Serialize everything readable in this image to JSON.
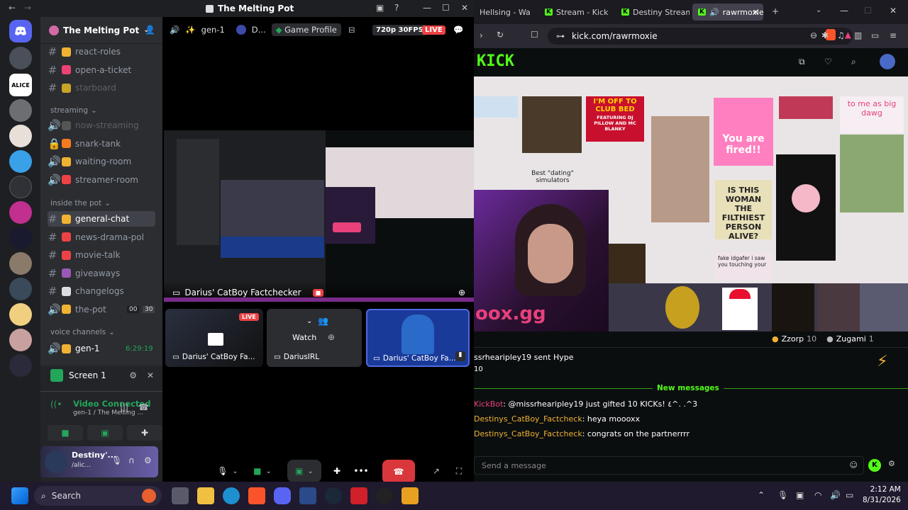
{
  "discord": {
    "window_title": "The Melting Pot",
    "guild_name": "The Melting Pot",
    "channels_top": [
      {
        "name": "react-roles",
        "color": "#f0b232"
      },
      {
        "name": "open-a-ticket",
        "color": "#ed4274"
      },
      {
        "name": "starboard",
        "color": "#c9a227"
      }
    ],
    "cat_streaming": "streaming",
    "streaming_channels": [
      {
        "name": "now-streaming",
        "color": "#555"
      },
      {
        "name": "snark-tank",
        "color": "#f47b20"
      },
      {
        "name": "waiting-room",
        "color": "#f0b232"
      },
      {
        "name": "streamer-room",
        "color": "#ed4245"
      }
    ],
    "cat_inside": "inside the pot",
    "inside_channels": [
      {
        "name": "general-chat",
        "color": "#f0b232"
      },
      {
        "name": "news-drama-pol",
        "color": "#ed4245"
      },
      {
        "name": "movie-talk",
        "color": "#ed4245"
      },
      {
        "name": "giveaways",
        "color": "#9b59b6"
      },
      {
        "name": "changelogs",
        "color": "#dbdee1"
      },
      {
        "name": "the-pot",
        "color": "#f0b232"
      }
    ],
    "the_pot_user_count": "00",
    "the_pot_limit": "30",
    "cat_voice": "voice channels",
    "voice_channel": "gen-1",
    "voice_timer": "6:29:19",
    "screen_label": "Screen 1",
    "voice_status": "Video Connected",
    "voice_sub": "gen-1 / The Melting ...",
    "user_name": "Destiny'...",
    "user_status": "/alic...",
    "stage": {
      "channel": "gen-1",
      "user_short": "D...",
      "game_profile": "Game Profile",
      "quality": "720p 30FPS",
      "live": "LIVE",
      "stream_name": "Darius' CatBoy Factchecker",
      "tiles": [
        {
          "label": "Darius' CatBoy Fa...",
          "live": "LIVE"
        },
        {
          "label": "DariusIRL",
          "watch": "Watch"
        },
        {
          "label": "Darius' CatBoy Fa..."
        }
      ]
    }
  },
  "browser": {
    "tabs": [
      "Hellsing - Wat",
      "Stream - Kick",
      "Destiny Stream",
      "rawrmoxie"
    ],
    "url": "kick.com/rawrmoxie",
    "kick_logo": "KICK",
    "feed": {
      "club_bed": "I'M OFF TO CLUB BED",
      "club_sub": "FEATURING DJ PILLOW AND MC BLANKY",
      "big_dawg": "to me as big dawg",
      "best_dating": "Best \"dating\" simulators",
      "fired": "You are fired!!",
      "filthiest": "IS THIS WOMAN THE FILTHIEST PERSON ALIVE?",
      "idgafer": "fake idgafer i saw you touching your",
      "watermark": "oox.gg"
    },
    "gifters": [
      {
        "name": "Zzorp",
        "count": "10"
      },
      {
        "name": "Zugami",
        "count": "1"
      }
    ],
    "hype_text": "ssrhearipley19 sent Hype",
    "hype_count": "10",
    "new_messages": "New messages",
    "messages": [
      {
        "user": "KickBot",
        "user_color": "#e8417b",
        "text": ": @missrhearipley19 just gifted 10 KICKs! ٤^. .^3"
      },
      {
        "user": "Destinys_CatBoy_Factcheck",
        "user_color": "#f0b232",
        "text": ": heya moooxx"
      },
      {
        "user": "Destinys_CatBoy_Factcheck",
        "user_color": "#f0b232",
        "text": ": congrats on the partnerrrr"
      }
    ],
    "chat_placeholder": "Send a message"
  },
  "taskbar": {
    "search": "Search",
    "time": "2:12 AM",
    "date": "8/31/2026"
  }
}
